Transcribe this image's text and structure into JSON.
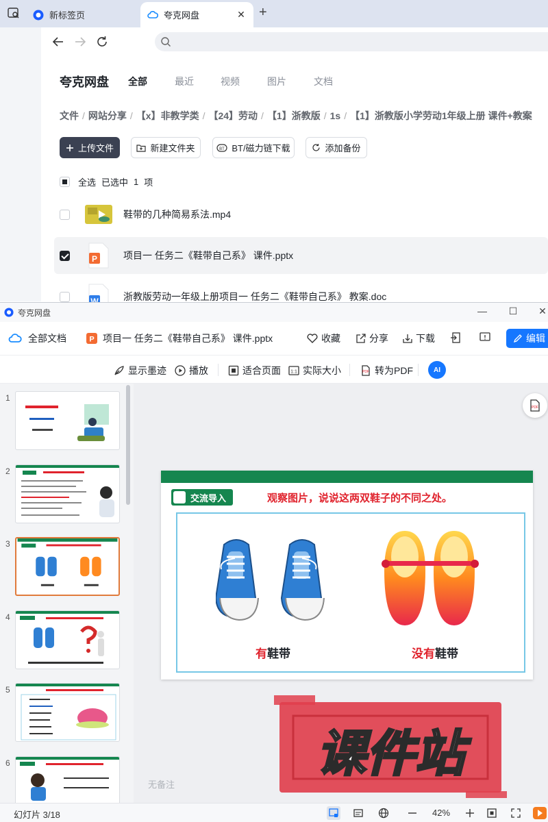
{
  "browser": {
    "tabs": [
      {
        "label": "新标签页",
        "active": false
      },
      {
        "label": "夸克网盘",
        "active": true
      }
    ],
    "close_glyph": "✕",
    "newtab_glyph": "+"
  },
  "drive": {
    "brand": "夸克网盘",
    "nav_tabs": [
      "全部",
      "最近",
      "视频",
      "图片",
      "文档"
    ],
    "breadcrumbs": [
      "文件",
      "网站分享",
      "【x】非教学类",
      "【24】劳动",
      "【1】浙教版",
      "1s",
      "【1】浙教版小学劳动1年级上册 课件+教案"
    ],
    "breadcrumb_sep": "/",
    "actions": {
      "upload": "上传文件",
      "new_folder": "新建文件夹",
      "bt_download": "BT/磁力链下载",
      "backup": "添加备份"
    },
    "select": {
      "all": "全选",
      "selected_prefix": "已选中",
      "count": "1",
      "unit": "项"
    },
    "files": [
      {
        "name": "鞋带的几种简易系法.mp4",
        "type": "video",
        "checked": false
      },
      {
        "name": "项目一 任务二《鞋带自己系》 课件.pptx",
        "type": "pptx",
        "checked": true
      },
      {
        "name": "浙教版劳动一年级上册项目一 任务二《鞋带自己系》 教案.doc",
        "type": "doc",
        "checked": false
      }
    ]
  },
  "preview": {
    "window_title": "夸克网盘",
    "winctl": {
      "min": "—",
      "max": "☐",
      "close": "✕"
    },
    "all_docs": "全部文档",
    "filename": "项目一 任务二《鞋带自己系》 课件.pptx",
    "header_actions": {
      "favorite": "收藏",
      "share": "分享",
      "download": "下载",
      "edit": "编辑"
    },
    "tools": {
      "ink": "显示墨迹",
      "play": "播放",
      "fit_page": "适合页面",
      "actual_size": "实际大小",
      "to_pdf": "转为PDF",
      "ai": "AI"
    },
    "thumbnails": [
      "1",
      "2",
      "3",
      "4",
      "5",
      "6"
    ],
    "selected_slide": 3,
    "slide": {
      "badge": "交流导入",
      "question": "观察图片，说说这两双鞋子的不同之处。",
      "left_caption_red": "有",
      "left_caption_rest": "鞋带",
      "right_caption_red": "没有",
      "right_caption_rest": "鞋带"
    },
    "watermark": "课件站",
    "notes": "无备注",
    "status": {
      "slide_indicator": "幻灯片 3/18",
      "zoom": "42%"
    }
  },
  "colors": {
    "slide_green": "#15864f",
    "slide_red": "#e0232d",
    "primary_blue": "#1677ff",
    "selected_orange": "#e07a3b"
  }
}
